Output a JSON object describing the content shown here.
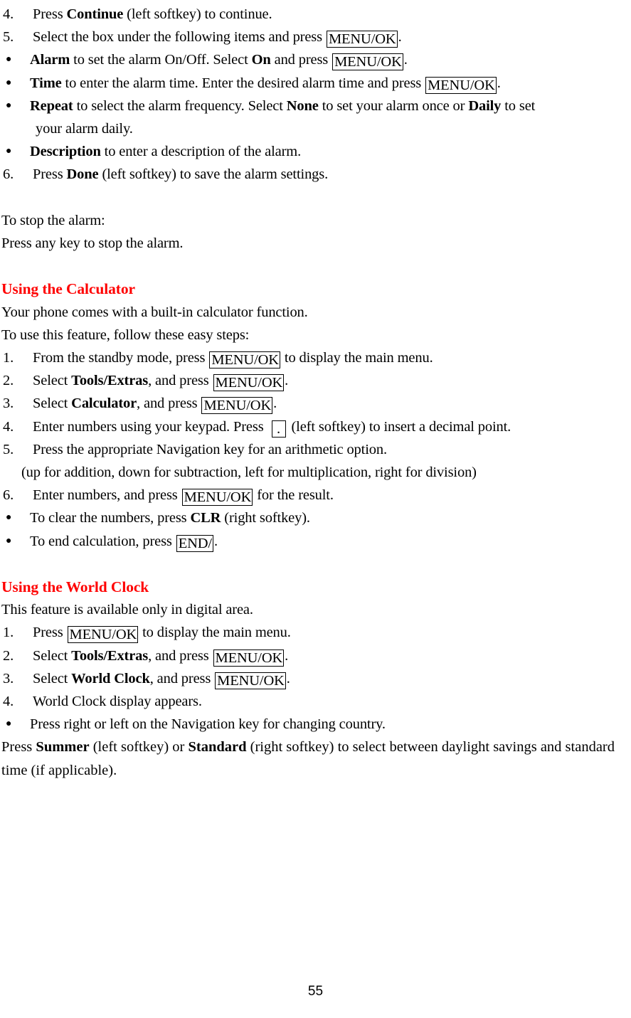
{
  "document": {
    "page_number": "55",
    "heading_color": "#ff0000"
  },
  "alarm_section": {
    "step4": {
      "marker": "4.",
      "pre": "Press ",
      "bold": "Continue",
      "post": " (left softkey) to continue."
    },
    "step5": {
      "marker": "5.",
      "pre": "Select the box under the following items and press ",
      "key": "MENU/OK",
      "post": "."
    },
    "bullet_alarm": {
      "marker": "●",
      "bold1": "Alarm",
      "mid1": " to set the alarm On/Off. Select ",
      "bold2": "On",
      "mid2": " and press ",
      "key": "MENU/OK",
      "post": "."
    },
    "bullet_time": {
      "marker": "●",
      "bold1": "Time",
      "mid1": " to enter the alarm time. Enter the desired alarm time and press ",
      "key": "MENU/OK",
      "post": "."
    },
    "bullet_repeat": {
      "marker": "●",
      "bold1": "Repeat",
      "mid1": " to select the alarm frequency. Select ",
      "bold2": "None",
      "mid2": " to set your alarm once or ",
      "bold3": "Daily",
      "mid3": " to set",
      "line2": "your alarm daily."
    },
    "bullet_description": {
      "marker": "●",
      "bold1": "Description",
      "mid1": " to enter a description of the alarm."
    },
    "step6": {
      "marker": "6.",
      "pre": "Press ",
      "bold": "Done",
      "post": " (left softkey) to save the alarm settings."
    },
    "stop_title": "To stop the alarm:",
    "stop_text": "Press any key to stop the alarm."
  },
  "calculator_section": {
    "heading": "Using the Calculator",
    "intro1": "Your phone comes with a built-in calculator function.",
    "intro2": "To use this feature, follow these easy steps:",
    "step1": {
      "marker": "1.",
      "pre": "From the standby mode, press ",
      "key": "MENU/OK",
      "post": " to display the main menu."
    },
    "step2": {
      "marker": "2.",
      "pre": "Select ",
      "bold": "Tools/Extras",
      "mid": ", and press ",
      "key": "MENU/OK",
      "post": "."
    },
    "step3": {
      "marker": "3.",
      "pre": "Select ",
      "bold": "Calculator",
      "mid": ", and press ",
      "key": "MENU/OK",
      "post": "."
    },
    "step4": {
      "marker": "4.",
      "pre": "Enter numbers using your keypad. Press ",
      "key": ".",
      "post": "(left softkey) to insert a decimal point."
    },
    "step5": {
      "marker": "5.",
      "text": "Press the appropriate Navigation key for an arithmetic option.",
      "continuation": "(up for addition, down for subtraction, left for multiplication, right for division)"
    },
    "step6": {
      "marker": "6.",
      "pre": "Enter numbers, and press ",
      "key": "MENU/OK",
      "post": " for the result."
    },
    "bullet_clear": {
      "marker": "●",
      "pre": "To clear the numbers, press ",
      "bold": "CLR",
      "post": " (right softkey)."
    },
    "bullet_end": {
      "marker": "●",
      "pre": "To end calculation, press ",
      "key": "END/",
      "post": "."
    }
  },
  "world_clock_section": {
    "heading": "Using the World Clock",
    "intro": "This feature is available only in digital area.",
    "step1": {
      "marker": "1.",
      "pre": "Press ",
      "key": "MENU/OK",
      "post": " to display the main menu."
    },
    "step2": {
      "marker": "2.",
      "pre": "Select ",
      "bold": "Tools/Extras",
      "mid": ", and press ",
      "key": "MENU/OK",
      "post": "."
    },
    "step3": {
      "marker": "3.",
      "pre": "Select ",
      "bold": "World Clock",
      "mid": ", and press ",
      "key": "MENU/OK",
      "post": "."
    },
    "step4": {
      "marker": "4.",
      "text": "World Clock display appears."
    },
    "bullet_nav": {
      "marker": "●",
      "text": "Press right or left on the Navigation key for changing country."
    },
    "closing": {
      "pre": "Press ",
      "bold1": "Summer",
      "mid1": " (left softkey) or ",
      "bold2": "Standard",
      "mid2": " (right softkey) to select between daylight savings and standard time (if applicable)."
    }
  }
}
